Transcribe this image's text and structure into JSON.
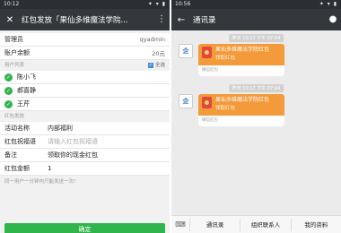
{
  "left": {
    "status": {
      "time": "10:12",
      "icons": "✦ ▾ ▮"
    },
    "title": "红包发放「果仙多维魔法学院...",
    "admin": {
      "label": "管理员",
      "value": "qyadmin"
    },
    "balance": {
      "label": "账户余额",
      "value": "20元"
    },
    "user_list_label": "用户列表",
    "select_all": "全选",
    "users": [
      "陈小飞",
      "郝喜静",
      "王芹"
    ],
    "packet_section_label": "红包发放",
    "form": [
      {
        "label": "活动名称",
        "value": "内部福利",
        "placeholder": false
      },
      {
        "label": "红包祝福语",
        "value": "请输入红包祝福语",
        "placeholder": true
      },
      {
        "label": "备注",
        "value": "领取你的现金红包",
        "placeholder": false
      },
      {
        "label": "红包金额",
        "value": "1",
        "placeholder": false
      }
    ],
    "hint": "同一用户一分钟内只能发送一次!",
    "confirm_label": "确定"
  },
  "right": {
    "status": {
      "time": "10:56",
      "icons": "✦ ▾ ▮"
    },
    "title": "通讯录",
    "timestamps": [
      "昨天 10:17 下午 07:44",
      "昨天 10:17 下午 07:44"
    ],
    "packets": [
      {
        "avatar": "企",
        "title": "果仙多维魔法学院红包",
        "sub": "领取红包",
        "footer": "微信红包"
      },
      {
        "avatar": "企",
        "title": "果仙多维魔法学院红包",
        "sub": "领取红包",
        "footer": "微信红包"
      }
    ],
    "tabs": [
      "通讯录",
      "组织联系人",
      "我的资料"
    ]
  },
  "colors": {
    "green": "#2fb54c",
    "orange": "#f39a3a",
    "topbar": "#34383c"
  }
}
